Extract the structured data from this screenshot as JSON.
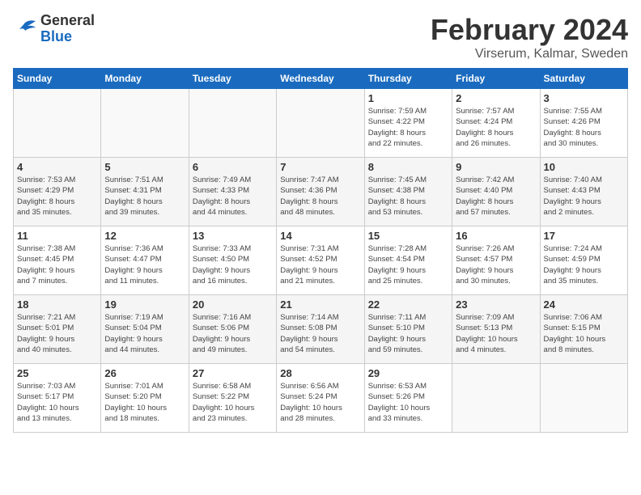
{
  "logo": {
    "general": "General",
    "blue": "Blue"
  },
  "header": {
    "title": "February 2024",
    "subtitle": "Virserum, Kalmar, Sweden"
  },
  "weekdays": [
    "Sunday",
    "Monday",
    "Tuesday",
    "Wednesday",
    "Thursday",
    "Friday",
    "Saturday"
  ],
  "weeks": [
    [
      {
        "day": "",
        "info": ""
      },
      {
        "day": "",
        "info": ""
      },
      {
        "day": "",
        "info": ""
      },
      {
        "day": "",
        "info": ""
      },
      {
        "day": "1",
        "info": "Sunrise: 7:59 AM\nSunset: 4:22 PM\nDaylight: 8 hours\nand 22 minutes."
      },
      {
        "day": "2",
        "info": "Sunrise: 7:57 AM\nSunset: 4:24 PM\nDaylight: 8 hours\nand 26 minutes."
      },
      {
        "day": "3",
        "info": "Sunrise: 7:55 AM\nSunset: 4:26 PM\nDaylight: 8 hours\nand 30 minutes."
      }
    ],
    [
      {
        "day": "4",
        "info": "Sunrise: 7:53 AM\nSunset: 4:29 PM\nDaylight: 8 hours\nand 35 minutes."
      },
      {
        "day": "5",
        "info": "Sunrise: 7:51 AM\nSunset: 4:31 PM\nDaylight: 8 hours\nand 39 minutes."
      },
      {
        "day": "6",
        "info": "Sunrise: 7:49 AM\nSunset: 4:33 PM\nDaylight: 8 hours\nand 44 minutes."
      },
      {
        "day": "7",
        "info": "Sunrise: 7:47 AM\nSunset: 4:36 PM\nDaylight: 8 hours\nand 48 minutes."
      },
      {
        "day": "8",
        "info": "Sunrise: 7:45 AM\nSunset: 4:38 PM\nDaylight: 8 hours\nand 53 minutes."
      },
      {
        "day": "9",
        "info": "Sunrise: 7:42 AM\nSunset: 4:40 PM\nDaylight: 8 hours\nand 57 minutes."
      },
      {
        "day": "10",
        "info": "Sunrise: 7:40 AM\nSunset: 4:43 PM\nDaylight: 9 hours\nand 2 minutes."
      }
    ],
    [
      {
        "day": "11",
        "info": "Sunrise: 7:38 AM\nSunset: 4:45 PM\nDaylight: 9 hours\nand 7 minutes."
      },
      {
        "day": "12",
        "info": "Sunrise: 7:36 AM\nSunset: 4:47 PM\nDaylight: 9 hours\nand 11 minutes."
      },
      {
        "day": "13",
        "info": "Sunrise: 7:33 AM\nSunset: 4:50 PM\nDaylight: 9 hours\nand 16 minutes."
      },
      {
        "day": "14",
        "info": "Sunrise: 7:31 AM\nSunset: 4:52 PM\nDaylight: 9 hours\nand 21 minutes."
      },
      {
        "day": "15",
        "info": "Sunrise: 7:28 AM\nSunset: 4:54 PM\nDaylight: 9 hours\nand 25 minutes."
      },
      {
        "day": "16",
        "info": "Sunrise: 7:26 AM\nSunset: 4:57 PM\nDaylight: 9 hours\nand 30 minutes."
      },
      {
        "day": "17",
        "info": "Sunrise: 7:24 AM\nSunset: 4:59 PM\nDaylight: 9 hours\nand 35 minutes."
      }
    ],
    [
      {
        "day": "18",
        "info": "Sunrise: 7:21 AM\nSunset: 5:01 PM\nDaylight: 9 hours\nand 40 minutes."
      },
      {
        "day": "19",
        "info": "Sunrise: 7:19 AM\nSunset: 5:04 PM\nDaylight: 9 hours\nand 44 minutes."
      },
      {
        "day": "20",
        "info": "Sunrise: 7:16 AM\nSunset: 5:06 PM\nDaylight: 9 hours\nand 49 minutes."
      },
      {
        "day": "21",
        "info": "Sunrise: 7:14 AM\nSunset: 5:08 PM\nDaylight: 9 hours\nand 54 minutes."
      },
      {
        "day": "22",
        "info": "Sunrise: 7:11 AM\nSunset: 5:10 PM\nDaylight: 9 hours\nand 59 minutes."
      },
      {
        "day": "23",
        "info": "Sunrise: 7:09 AM\nSunset: 5:13 PM\nDaylight: 10 hours\nand 4 minutes."
      },
      {
        "day": "24",
        "info": "Sunrise: 7:06 AM\nSunset: 5:15 PM\nDaylight: 10 hours\nand 8 minutes."
      }
    ],
    [
      {
        "day": "25",
        "info": "Sunrise: 7:03 AM\nSunset: 5:17 PM\nDaylight: 10 hours\nand 13 minutes."
      },
      {
        "day": "26",
        "info": "Sunrise: 7:01 AM\nSunset: 5:20 PM\nDaylight: 10 hours\nand 18 minutes."
      },
      {
        "day": "27",
        "info": "Sunrise: 6:58 AM\nSunset: 5:22 PM\nDaylight: 10 hours\nand 23 minutes."
      },
      {
        "day": "28",
        "info": "Sunrise: 6:56 AM\nSunset: 5:24 PM\nDaylight: 10 hours\nand 28 minutes."
      },
      {
        "day": "29",
        "info": "Sunrise: 6:53 AM\nSunset: 5:26 PM\nDaylight: 10 hours\nand 33 minutes."
      },
      {
        "day": "",
        "info": ""
      },
      {
        "day": "",
        "info": ""
      }
    ]
  ]
}
